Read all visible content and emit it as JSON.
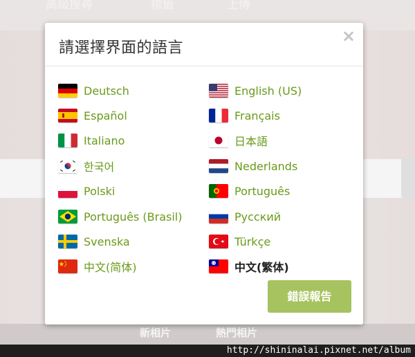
{
  "background": {
    "top_nav": [
      "高級搜尋",
      "標籤",
      "上傳"
    ],
    "bottom_nav": [
      "新相片",
      "熱門相片"
    ]
  },
  "watermark": "http://shininalai.pixnet.net/album",
  "dialog": {
    "title": "請選擇界面的語言",
    "close_label": "×",
    "report_label": "錯誤報告",
    "languages": [
      {
        "label": "Deutsch",
        "flag": "germany-flag-icon"
      },
      {
        "label": "English (US)",
        "flag": "usa-flag-icon"
      },
      {
        "label": "Español",
        "flag": "spain-flag-icon"
      },
      {
        "label": "Français",
        "flag": "france-flag-icon"
      },
      {
        "label": "Italiano",
        "flag": "italy-flag-icon"
      },
      {
        "label": "日本語",
        "flag": "japan-flag-icon"
      },
      {
        "label": "한국어",
        "flag": "korea-flag-icon"
      },
      {
        "label": "Nederlands",
        "flag": "netherlands-flag-icon"
      },
      {
        "label": "Polski",
        "flag": "poland-flag-icon"
      },
      {
        "label": "Português",
        "flag": "portugal-flag-icon"
      },
      {
        "label": "Português (Brasil)",
        "flag": "brazil-flag-icon"
      },
      {
        "label": "Русский",
        "flag": "russia-flag-icon"
      },
      {
        "label": "Svenska",
        "flag": "sweden-flag-icon"
      },
      {
        "label": "Türkçe",
        "flag": "turkey-flag-icon"
      },
      {
        "label": "中文(简体)",
        "flag": "china-flag-icon"
      },
      {
        "label": "中文(繁体)",
        "flag": "taiwan-flag-icon",
        "current": true
      }
    ]
  },
  "colors": {
    "link": "#6a9a1a",
    "current": "#222222",
    "button": "#a7c35f"
  }
}
